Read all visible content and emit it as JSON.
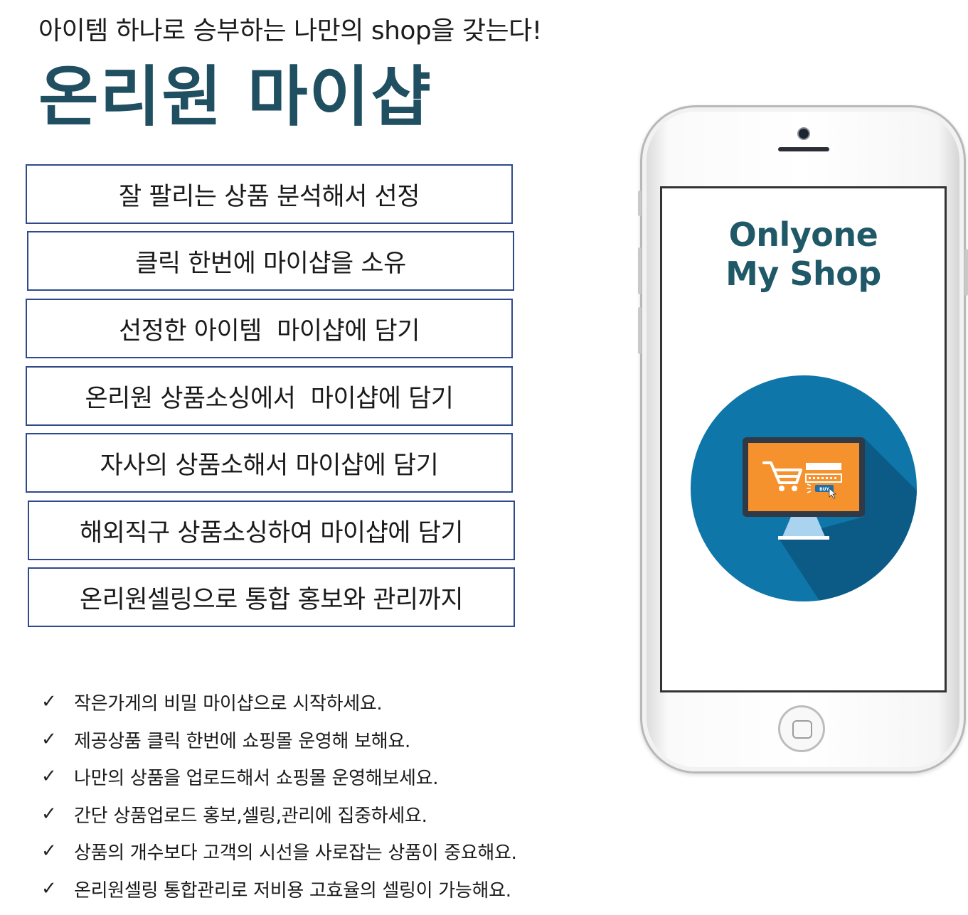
{
  "header": {
    "subtitle": "아이템 하나로 승부하는 나만의 shop을 갖는다!",
    "title": "온리원 마이샵"
  },
  "features": [
    "잘 팔리는 상품 분석해서 선정",
    "클릭 한번에 마이샵을 소유",
    "선정한 아이템  마이샵에 담기",
    "온리원 상품소싱에서  마이샵에 담기",
    "자사의 상품소해서 마이샵에 담기",
    "해외직구 상품소싱하여 마이샵에 담기",
    "온리원셀링으로 통합 홍보와 관리까지"
  ],
  "checklist": {
    "mark": "✓",
    "items": [
      "작은가게의 비밀 마이샵으로 시작하세요.",
      "제공상품 클릭 한번에 쇼핑몰 운영해 보해요.",
      "나만의 상품을 업로드해서 쇼핑몰 운영해보세요.",
      "간단 상품업로드 홍보,셀링,관리에 집중하세요.",
      "상품의 개수보다 고객의 시선을 사로잡는 상품이 중요해요.",
      "온리원셀링 통합관리로 저비용 고효율의 셀링이 가능해요."
    ]
  },
  "phone": {
    "screen_title_line1": "Onlyone",
    "screen_title_line2": "My Shop",
    "buy_label": "BUY",
    "icon": "shopping-monitor-icon",
    "colors": {
      "circle": "#0e76a8",
      "circle_shadow": "#0b5b86",
      "monitor_bezel": "#2f3a46",
      "monitor_screen": "#f6922e",
      "monitor_stand": "#a9d3ee",
      "title_text": "#1f5866"
    }
  },
  "colors": {
    "title": "#1f4f60",
    "box_border": "#2f4a8c"
  }
}
